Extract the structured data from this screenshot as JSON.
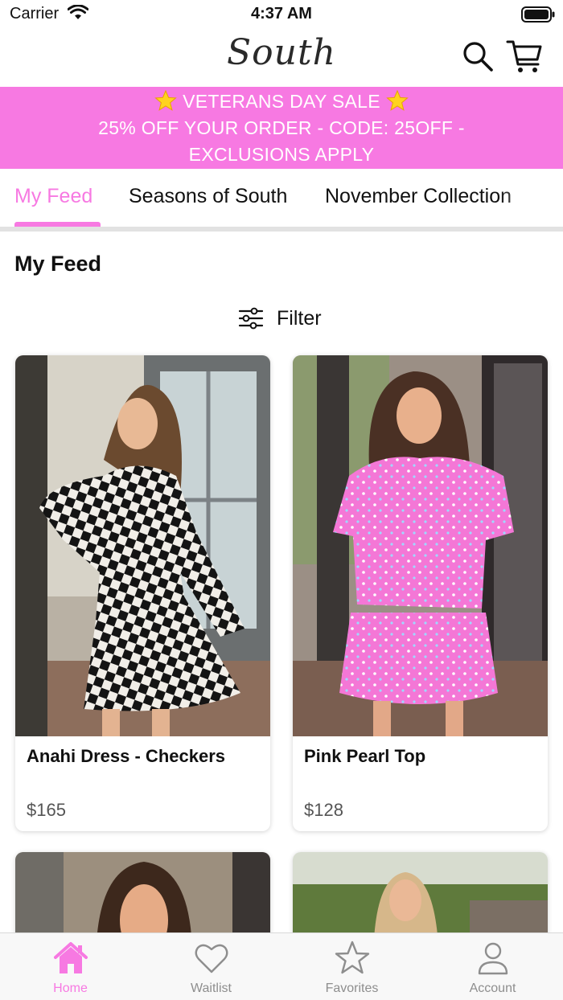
{
  "status_bar": {
    "carrier": "Carrier",
    "time": "4:37 AM"
  },
  "nav": {
    "brand": "South",
    "search_icon": "search-icon",
    "cart_icon": "cart-icon"
  },
  "promo": {
    "line1": "VETERANS DAY SALE",
    "line2": "25% OFF YOUR ORDER - CODE: 25OFF -",
    "line3": "EXCLUSIONS APPLY",
    "background": "#f779e2"
  },
  "tabs": [
    {
      "label": "My Feed",
      "active": true
    },
    {
      "label": "Seasons of South",
      "active": false
    },
    {
      "label": "November Collection",
      "active": false
    }
  ],
  "feed": {
    "title": "My Feed",
    "filter_label": "Filter"
  },
  "products": [
    {
      "name": "Anahi Dress - Checkers",
      "price": "$165"
    },
    {
      "name": "Pink Pearl Top",
      "price": "$128"
    },
    {
      "name": "",
      "price": ""
    },
    {
      "name": "",
      "price": ""
    }
  ],
  "bottom_nav": [
    {
      "label": "Home",
      "icon": "home-icon",
      "active": true
    },
    {
      "label": "Waitlist",
      "icon": "heart-icon",
      "active": false
    },
    {
      "label": "Favorites",
      "icon": "star-icon",
      "active": false
    },
    {
      "label": "Account",
      "icon": "person-icon",
      "active": false
    }
  ],
  "colors": {
    "accent": "#f779e2",
    "inactive": "#8e8e8e"
  }
}
